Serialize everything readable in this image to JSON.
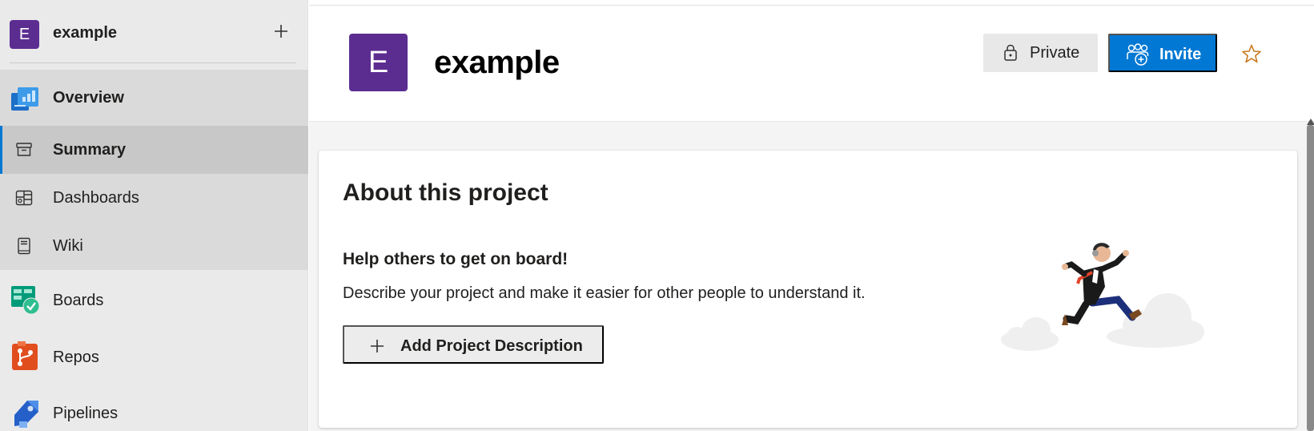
{
  "project": {
    "initial": "E",
    "name": "example",
    "add_icon": "plus-icon"
  },
  "sidebar": {
    "overview": {
      "label": "Overview",
      "icon": "overview-icon"
    },
    "sub_items": [
      {
        "label": "Summary",
        "icon": "summary-icon",
        "selected": true
      },
      {
        "label": "Dashboards",
        "icon": "dashboards-icon",
        "selected": false
      },
      {
        "label": "Wiki",
        "icon": "wiki-icon",
        "selected": false
      }
    ],
    "main_items": [
      {
        "label": "Boards",
        "icon": "boards-icon"
      },
      {
        "label": "Repos",
        "icon": "repos-icon"
      },
      {
        "label": "Pipelines",
        "icon": "pipelines-icon"
      }
    ]
  },
  "header": {
    "title": "example",
    "private_label": "Private",
    "invite_label": "Invite",
    "favorite_icon": "star-icon"
  },
  "about": {
    "title": "About this project",
    "subtitle": "Help others to get on board!",
    "description": "Describe your project and make it easier for other people to understand it.",
    "add_button_label": "Add Project Description"
  },
  "colors": {
    "project_avatar": "#5c2d91",
    "primary_button": "#0078d4",
    "favorite_star": "#c87a1e"
  }
}
